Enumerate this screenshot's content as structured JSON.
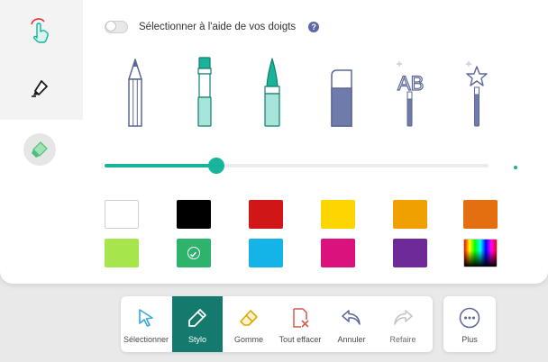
{
  "settings": {
    "finger_select_label": "Sélectionner à l'aide de vos doigts",
    "finger_select_enabled": false,
    "help_glyph": "?"
  },
  "modes": [
    {
      "name": "finger-touch-icon",
      "active": false
    },
    {
      "name": "pen-mode-icon",
      "active": false
    },
    {
      "name": "highlighter-mode-icon",
      "active": true
    }
  ],
  "pen_tools": [
    {
      "name": "pencil-icon",
      "selected": false
    },
    {
      "name": "brush-icon",
      "selected": true
    },
    {
      "name": "marker-icon",
      "selected": false
    },
    {
      "name": "eraser-tool-icon",
      "selected": false
    },
    {
      "name": "text-wand-icon",
      "selected": false,
      "text": "AB"
    },
    {
      "name": "magic-wand-icon",
      "selected": false
    }
  ],
  "stroke_size": {
    "value_fraction": 0.29
  },
  "palette": {
    "colors": [
      "#ffffff",
      "#000000",
      "#d01616",
      "#ffd500",
      "#f0a000",
      "#e36f10",
      "#a6e64c",
      "#2db36b",
      "#14b3e8",
      "#d9127e",
      "#6f2a9a",
      "spectrum"
    ],
    "selected_index": 7
  },
  "accent": "#18b39b",
  "toolbar": {
    "select_label": "Sélectionner",
    "pen_label": "Stylo",
    "eraser_label": "Gomme",
    "clear_label": "Tout effacer",
    "undo_label": "Annuler",
    "redo_label": "Refaire",
    "more_label": "Plus"
  }
}
